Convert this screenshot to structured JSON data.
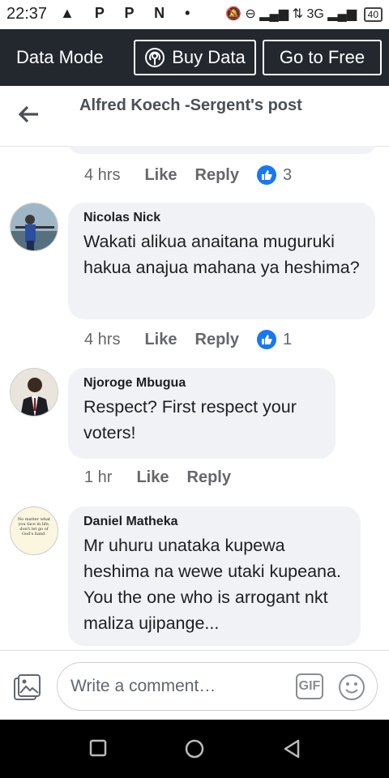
{
  "status_bar": {
    "time": "22:37",
    "left_icons": "▲ P P N •",
    "right_icons": "🔕 ⊖ ▂▄▆ ⇅ 3G ▂▄▆",
    "battery": "40"
  },
  "data_bar": {
    "mode_label": "Data Mode",
    "buy_label": "Buy Data",
    "free_label": "Go to Free"
  },
  "header": {
    "title": "Alfred Koech -Sergent's post"
  },
  "first_meta": {
    "time": "4 hrs",
    "like": "Like",
    "reply": "Reply",
    "reactions": "3"
  },
  "comments": [
    {
      "name": "Nicolas Nick",
      "text": "Wakati alikua anaitana muguruki hakua anajua mahana ya heshima?",
      "time": "4 hrs",
      "like": "Like",
      "reply": "Reply",
      "reactions": "1"
    },
    {
      "name": "Njoroge Mbugua",
      "text": "Respect? First respect your voters!",
      "time": "1 hr",
      "like": "Like",
      "reply": "Reply"
    },
    {
      "name": "Daniel Matheka",
      "text": "Mr uhuru unataka kupewa heshima na wewe utaki kupeana. You the one who is arrogant nkt maliza ujipange...",
      "avatar_text": "No matter what you face in life, don't let go of God's hand."
    }
  ],
  "composer": {
    "placeholder": "Write a comment…",
    "gif_label": "GIF"
  },
  "colors": {
    "data_bar_bg": "#23282e",
    "like_blue": "#1877f2",
    "bubble_bg": "#f0f2f5"
  }
}
